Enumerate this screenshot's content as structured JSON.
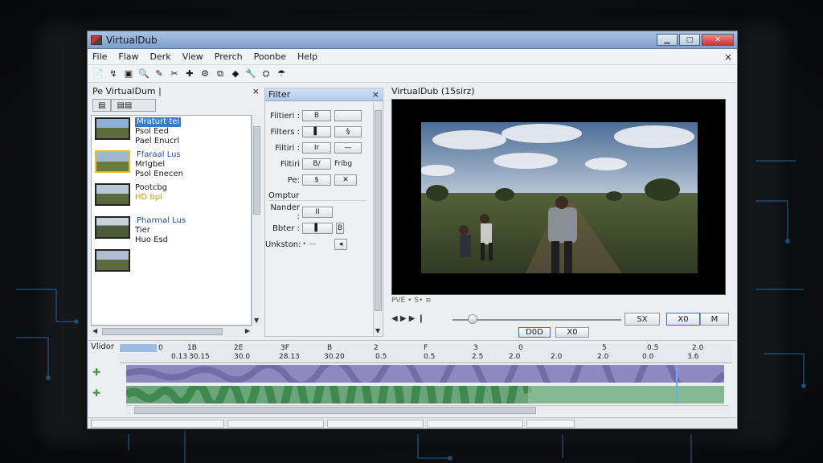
{
  "window": {
    "title": "VirtualDub",
    "min": "▁",
    "max": "□",
    "close": "✕"
  },
  "menu": [
    "File",
    "Flaw",
    "Derk",
    "View",
    "Prerch",
    "Poonbe",
    "Help"
  ],
  "menu_close": "×",
  "toolbar": [
    "📄",
    "↯",
    "▣",
    "🔍",
    "✎",
    "✂",
    "✚",
    "⚙",
    "⧉",
    "◆",
    "🔧",
    "⛭",
    "☂"
  ],
  "left_panel": {
    "title": "Pe VirtualDum |",
    "close": "×",
    "tabs": [
      "▤",
      "▤▤"
    ],
    "files": [
      {
        "name": "Mraturt tei",
        "l2": "Psol Eed",
        "l3": "Pael Enucrl",
        "selected": true,
        "highlight": false
      },
      {
        "name": "Ffaraal Lus",
        "l2": "Mrlgbel",
        "l3": "Psol Enecen",
        "selected": false,
        "highlight": true
      },
      {
        "name": "Pootcbg",
        "l2": "HD bpl",
        "l3": "",
        "selected": false,
        "highlight": false
      },
      {
        "name": "Pharmal Lus",
        "l2": "Tier",
        "l3": "Huo Esd",
        "selected": false,
        "highlight": false
      },
      {
        "name": "",
        "l2": "",
        "l3": "",
        "selected": false,
        "highlight": false
      }
    ]
  },
  "filter_panel": {
    "title": "Filter",
    "close": "×",
    "rows": [
      {
        "label": "Filtieri :",
        "b1": "B",
        "b2": ""
      },
      {
        "label": "Filters :",
        "b1": "▌",
        "b2": "§"
      },
      {
        "label": "Filtiri :",
        "b1": "Ir",
        "b2": "—"
      },
      {
        "label": "Filtiri",
        "b1": "B/",
        "b2": "Fribg"
      },
      {
        "label": "Pe:",
        "b1": "$",
        "b2": "✕"
      }
    ],
    "section": "Omptur",
    "rows2": [
      {
        "label": "Nander :",
        "b1": "II",
        "b2": ""
      },
      {
        "label": "Bbter :",
        "b1": "▌",
        "b2": "B"
      },
      {
        "label": "Unkston:",
        "b1": "• —",
        "b2": "◂"
      }
    ]
  },
  "preview": {
    "title": "VirtualDub (15sirz)",
    "transport_label": "PVE • S• ≡",
    "btn_right1": "SX",
    "btn_right2": "X0",
    "btn_right3": "M",
    "btn_mid1": "D0D",
    "btn_mid2": "X0",
    "slider_pos": 0.12
  },
  "timeline": {
    "label": "Vlidor",
    "ticks": [
      "0",
      "1B",
      "2E",
      "3F",
      "B",
      "2",
      "F",
      "3",
      "0",
      "5",
      "0.5",
      "2.0",
      "5",
      "8.0",
      "2.5",
      "6.5",
      "1.0"
    ],
    "numbers": [
      "0.13",
      "30.15",
      "30.0",
      "28.13",
      "30.20",
      "0.5",
      "0.5",
      "2.5",
      "2.0",
      "2.0",
      "2.0",
      "0.0",
      "3.6"
    ]
  },
  "colors": {
    "accent": "#3f79c6",
    "video_track": "#8e8ac0",
    "audio_track": "#6aa67a"
  }
}
